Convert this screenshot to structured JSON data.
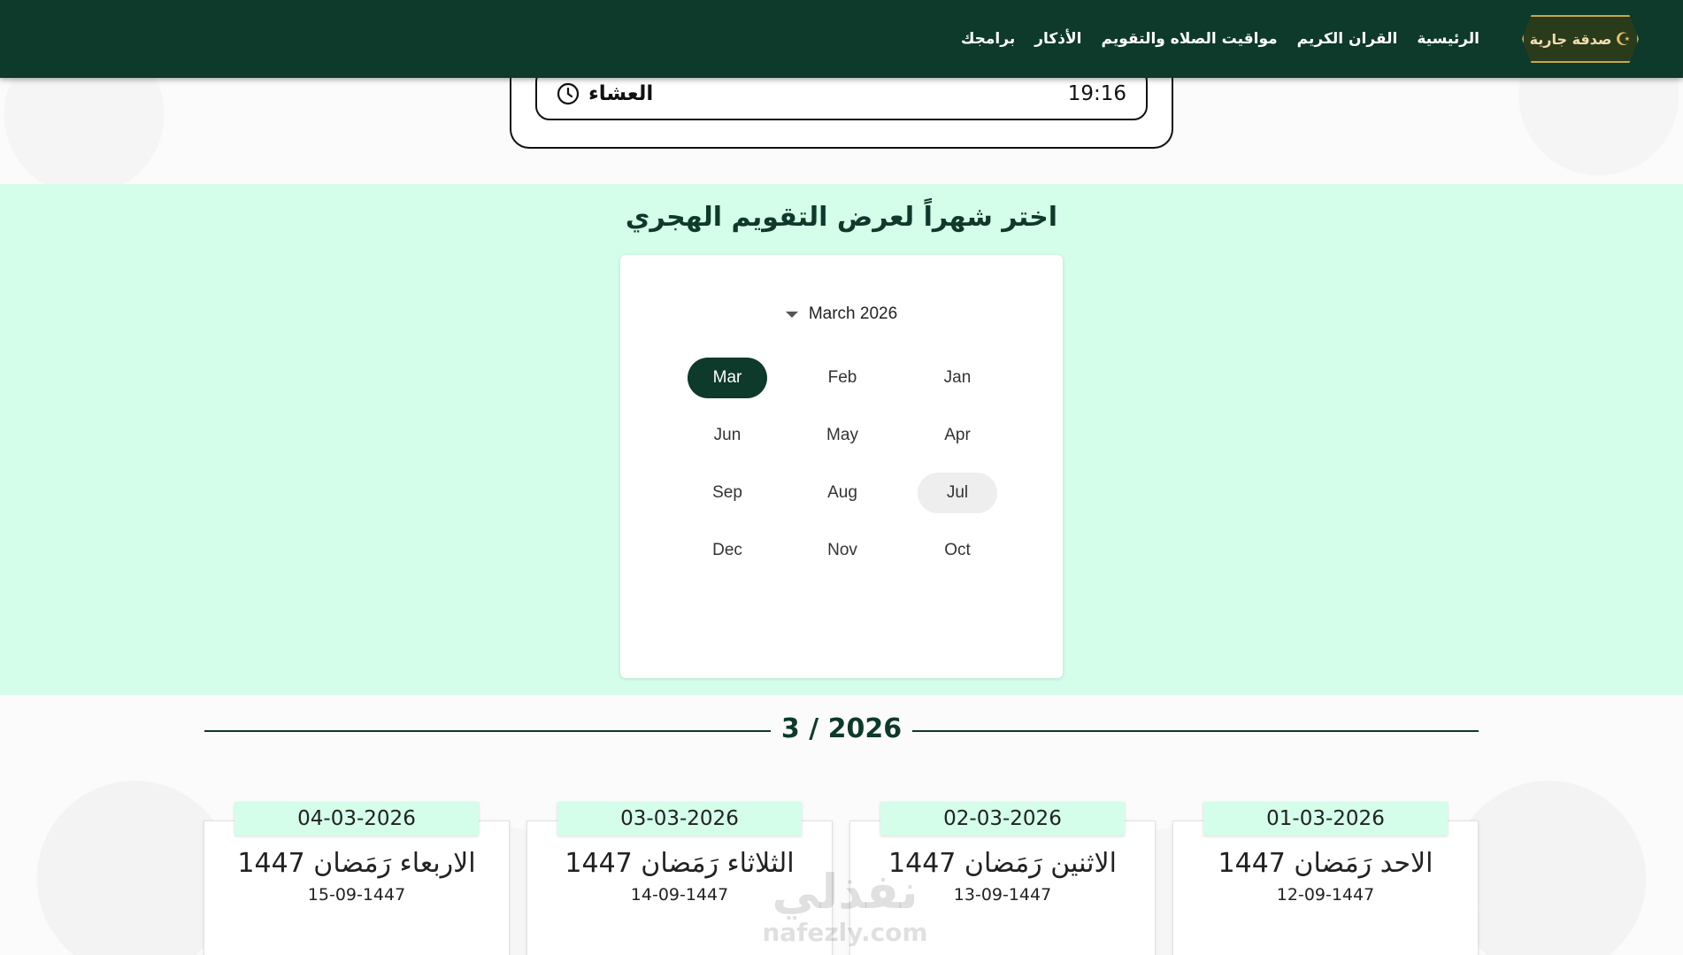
{
  "header": {
    "logo_text": "صدقة جارية",
    "nav": [
      "الرئيسية",
      "القران الكريم",
      "مواقيت الصلاه والتقويم",
      "الأذكار",
      "برامجك"
    ]
  },
  "prayer": {
    "name": "العشاء",
    "time": "19:16"
  },
  "calendar": {
    "title": "اختر شهراً لعرض التقويم الهجري",
    "picker_label": "March 2026",
    "selected_month": "Mar",
    "hovered_month": "Jul",
    "months": [
      [
        "Mar",
        "Feb",
        "Jan"
      ],
      [
        "Jun",
        "May",
        "Apr"
      ],
      [
        "Sep",
        "Aug",
        "Jul"
      ],
      [
        "Dec",
        "Nov",
        "Oct"
      ]
    ]
  },
  "results": {
    "heading": "3 / 2026",
    "days": [
      {
        "date": "01-03-2026",
        "name": "الاحد رَمَضان 1447",
        "hijri": "12-09-1447"
      },
      {
        "date": "02-03-2026",
        "name": "الاثنين رَمَضان 1447",
        "hijri": "13-09-1447"
      },
      {
        "date": "03-03-2026",
        "name": "الثلاثاء رَمَضان 1447",
        "hijri": "14-09-1447"
      },
      {
        "date": "04-03-2026",
        "name": "الاربعاء رَمَضان 1447",
        "hijri": "15-09-1447"
      }
    ]
  },
  "watermark": {
    "line1": "نفذلي",
    "line2": "nafezly.com"
  }
}
